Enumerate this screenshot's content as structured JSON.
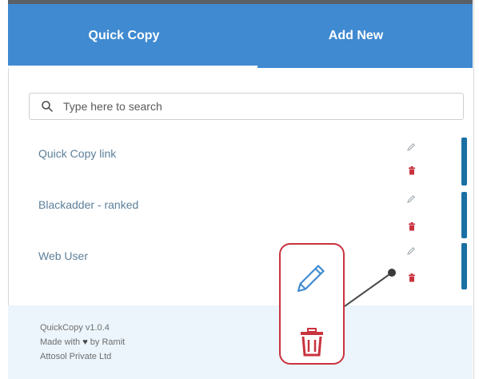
{
  "tabs": [
    {
      "label": "Quick Copy",
      "active": true
    },
    {
      "label": "Add New",
      "active": false
    }
  ],
  "search": {
    "placeholder": "Type here to search",
    "value": ""
  },
  "items": [
    {
      "label": "Quick Copy link"
    },
    {
      "label": "Blackadder - ranked"
    },
    {
      "label": "Web User"
    }
  ],
  "footer": {
    "version": "QuickCopy v1.0.4",
    "made_prefix": "Made with",
    "heart": "♥",
    "made_suffix": "by Ramit",
    "company": "Attosol Private Ltd"
  },
  "icons": {
    "search": "search-icon",
    "edit": "pencil-icon",
    "delete": "trash-icon"
  },
  "colors": {
    "header": "#3f8ad1",
    "item_text": "#5c7f99",
    "edit_icon": "#9aa6ae",
    "delete_icon": "#c9333f",
    "side_bar": "#1a6fa3",
    "footer_bg": "#ecf5fc",
    "callout_border": "#c9333f",
    "callout_pencil": "#3f8ad1"
  }
}
